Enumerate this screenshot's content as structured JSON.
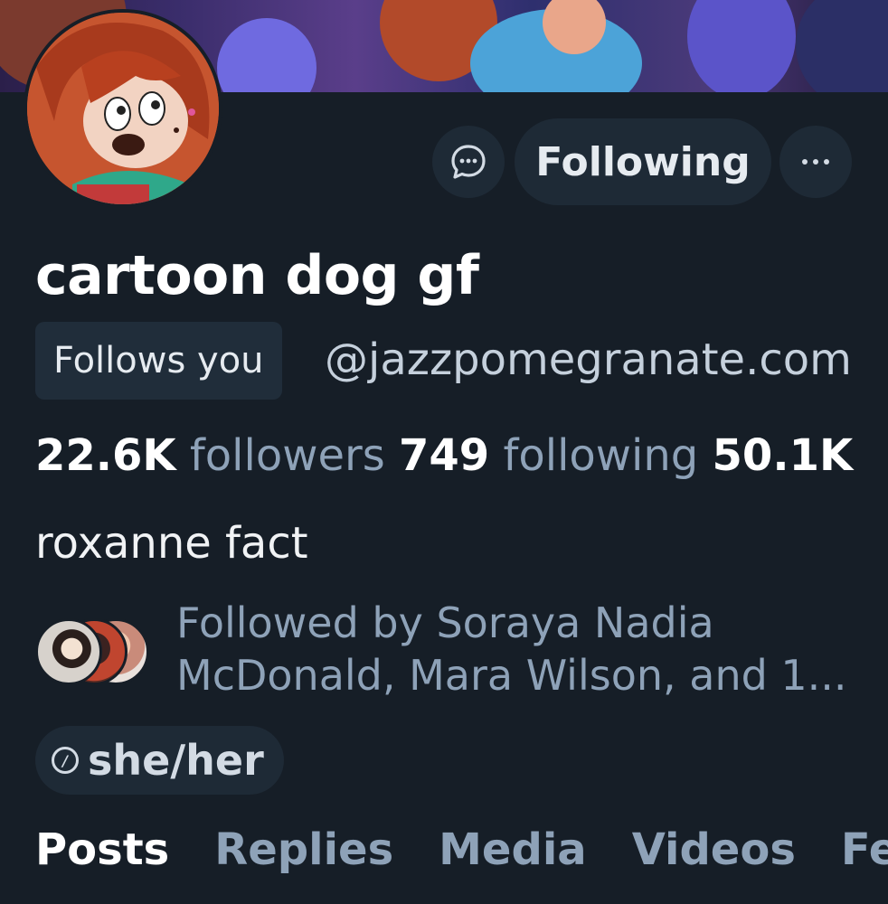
{
  "profile": {
    "display_name": "cartoon dog gf",
    "follows_you_badge": "Follows you",
    "handle": "@jazzpomegranate.com",
    "bio": "roxanne fact",
    "pronouns": "she/her"
  },
  "actions": {
    "message_icon": "chat-bubble-icon",
    "following_label": "Following",
    "more_label": "···"
  },
  "stats": {
    "followers_count": "22.6K",
    "followers_label": "followers",
    "following_count": "749",
    "following_label": "following",
    "posts_count": "50.1K"
  },
  "known_followers": {
    "text": "Followed by Soraya Nadia McDonald, Mara Wilson, and 1..."
  },
  "tabs": [
    {
      "label": "Posts",
      "active": true
    },
    {
      "label": "Replies",
      "active": false
    },
    {
      "label": "Media",
      "active": false
    },
    {
      "label": "Videos",
      "active": false
    },
    {
      "label": "Feeds",
      "active": false
    }
  ],
  "colors": {
    "background": "#161e27",
    "button_bg": "#1e2a36",
    "muted_text": "#8ea2b8"
  }
}
